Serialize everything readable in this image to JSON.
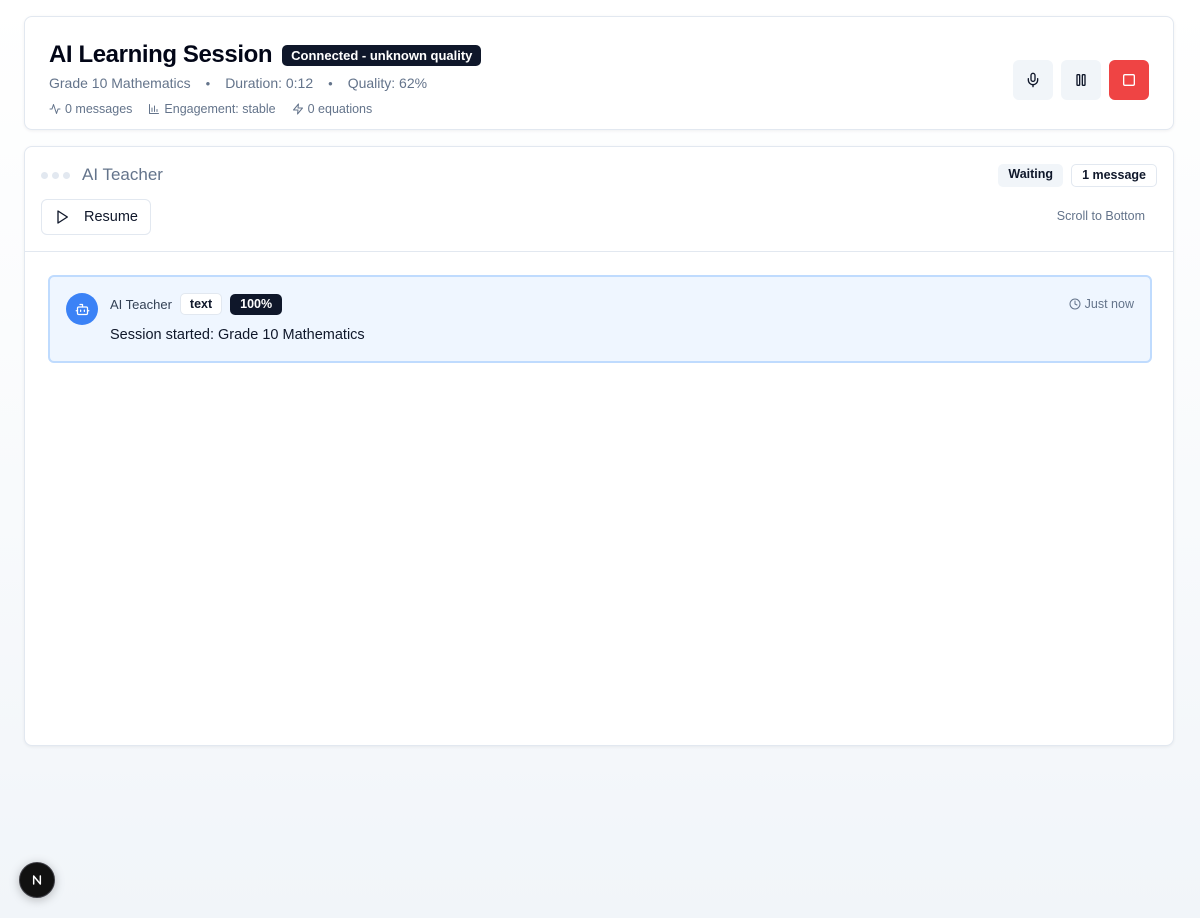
{
  "header": {
    "title": "AI Learning Session",
    "connection_status": "Connected - unknown quality",
    "subject": "Grade 10 Mathematics",
    "duration": "Duration: 0:12",
    "quality": "Quality: 62%",
    "meta_separator": "•",
    "stats": {
      "messages": "0 messages",
      "engagement": "Engagement: stable",
      "equations": "0 equations"
    },
    "controls": [
      {
        "name": "microphone",
        "icon": "mic-icon"
      },
      {
        "name": "pause",
        "icon": "pause-icon"
      },
      {
        "name": "stop",
        "icon": "stop-icon",
        "color": "#ef4444"
      }
    ]
  },
  "chat": {
    "teacher_name": "AI Teacher",
    "state_badge": "Waiting",
    "count_badge": "1 message",
    "resume_label": "Resume",
    "scroll_label": "Scroll to Bottom",
    "messages": [
      {
        "sender": "AI Teacher",
        "type": "text",
        "confidence": "100%",
        "time": "Just now",
        "text": "Session started: Grade 10 Mathematics",
        "icon": "bot-icon"
      }
    ]
  },
  "dev_tools": {
    "icon": "next-logo-icon",
    "letter": "N"
  },
  "colors": {
    "accent": "#3b82f6",
    "danger": "#ef4444",
    "dark": "#0f172a",
    "message_bg": "#eff6ff",
    "message_border": "#bfdbfe"
  }
}
